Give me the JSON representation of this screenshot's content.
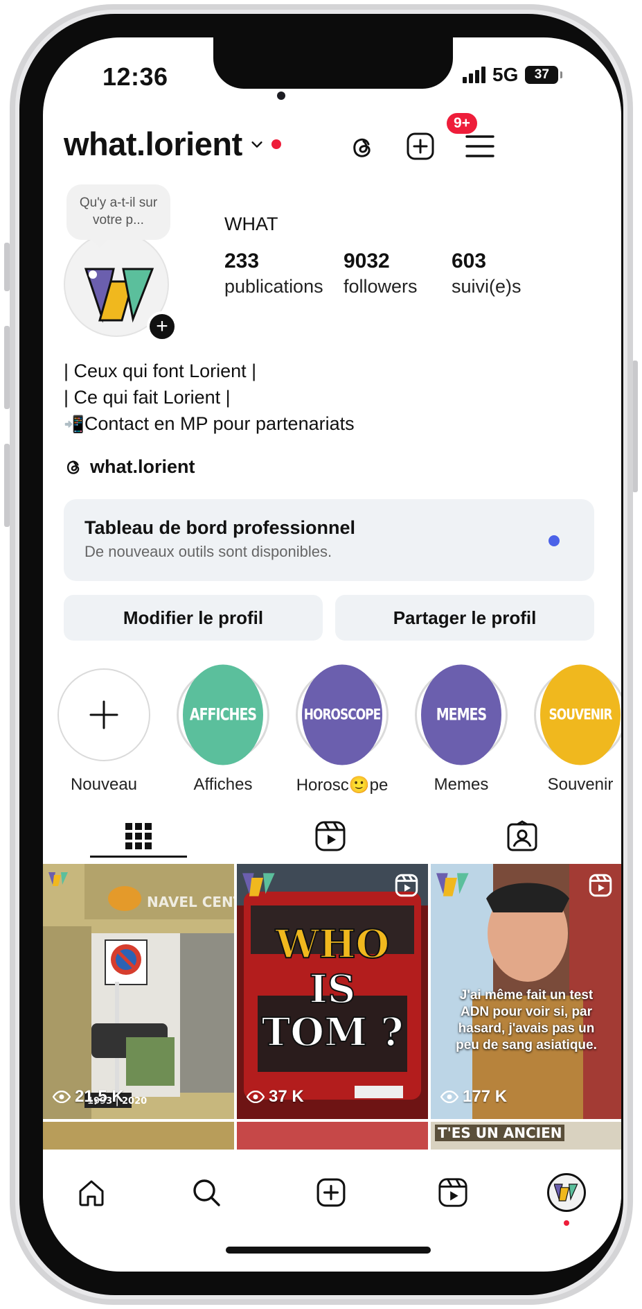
{
  "status": {
    "time": "12:36",
    "network": "5G",
    "battery": "37"
  },
  "header": {
    "username": "what.lorient",
    "threads_badge": "9+"
  },
  "note_bubble": "Qu'y a-t-il sur votre p...",
  "profile": {
    "display_name": "WHAT",
    "stats": [
      {
        "value": "233",
        "label": "publications"
      },
      {
        "value": "9032",
        "label": "followers"
      },
      {
        "value": "603",
        "label": "suivi(e)s"
      }
    ],
    "bio": [
      "| Ceux qui font Lorient |",
      "| Ce qui fait Lorient |",
      "Contact en MP pour partenariats"
    ],
    "bio_emoji": "📲",
    "threads_handle": "what.lorient"
  },
  "dashboard": {
    "title": "Tableau de bord professionnel",
    "subtitle": "De nouveaux outils sont disponibles."
  },
  "buttons": {
    "edit": "Modifier le profil",
    "share": "Partager le profil"
  },
  "highlights": [
    {
      "label": "Nouveau",
      "cover": "",
      "color": "#ffffff"
    },
    {
      "label": "Affiches",
      "cover": "AFFICHES",
      "color": "#5bbf9c"
    },
    {
      "label_pre": "Horosc",
      "label_emoji": "🙂",
      "label_post": "pe",
      "cover": "HOROSCOPE",
      "color": "#6b5fae"
    },
    {
      "label": "Memes",
      "cover": "MEMES",
      "color": "#6b5fae"
    },
    {
      "label": "Souvenir",
      "cover": "SOUVENIR",
      "color": "#f0b81e"
    }
  ],
  "posts": [
    {
      "views": "21,5 K",
      "caption": "1993 | 2020",
      "type": "post"
    },
    {
      "views": "37 K",
      "caption": "WHO IS TOM ?",
      "type": "reel"
    },
    {
      "views": "177 K",
      "caption": "J'ai même fait un test ADN pour voir si, par hasard, j'avais pas un peu de sang asiatique.",
      "type": "reel"
    }
  ],
  "next_row_caption": "T'ES UN ANCIEN",
  "colors": {
    "accent_red": "#ee1d3a",
    "blue_dot": "#4b62e8",
    "logo_purple": "#6b5fae",
    "logo_yellow": "#f0b81e",
    "logo_green": "#5bbf9c"
  }
}
